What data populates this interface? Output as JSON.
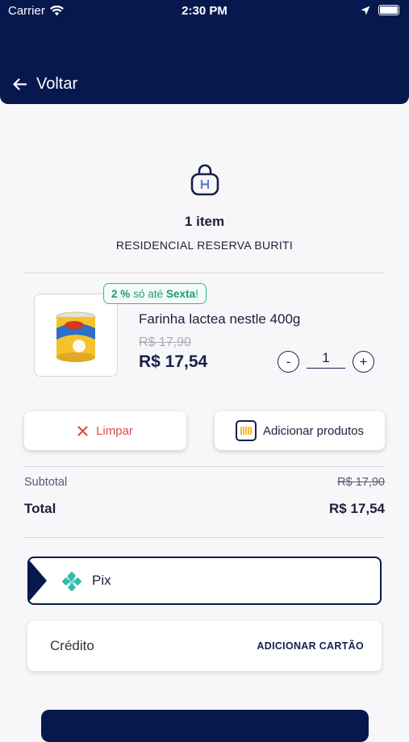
{
  "status_bar": {
    "carrier": "Carrier",
    "time": "2:30 PM"
  },
  "header": {
    "back_label": "Voltar"
  },
  "cart": {
    "count_label": "1 item",
    "location": "RESIDENCIAL RESERVA BURITI"
  },
  "item": {
    "promo_percent": "2 %",
    "promo_text": "só até",
    "promo_day": "Sexta",
    "promo_end": "!",
    "name": "Farinha lactea nestle 400g",
    "old_price": "R$ 17,90",
    "price": "R$ 17,54",
    "quantity": "1",
    "minus_label": "-",
    "plus_label": "+"
  },
  "actions": {
    "clear_label": "Limpar",
    "add_label": "Adicionar produtos"
  },
  "summary": {
    "subtotal_label": "Subtotal",
    "subtotal_value": "R$ 17,90",
    "total_label": "Total",
    "total_value": "R$ 17,54"
  },
  "payment": {
    "pix_label": "Pix",
    "credit_label": "Crédito",
    "credit_action": "ADICIONAR CARTÃO"
  },
  "colors": {
    "brand": "#07184f",
    "promo": "#2fbf8a",
    "danger": "#e24a4a",
    "pix": "#32bcad"
  },
  "icons": [
    "wifi-icon",
    "location-arrow-icon",
    "battery-icon",
    "back-arrow-icon",
    "shopping-bag-icon",
    "close-icon",
    "basket-icon",
    "pix-icon"
  ]
}
